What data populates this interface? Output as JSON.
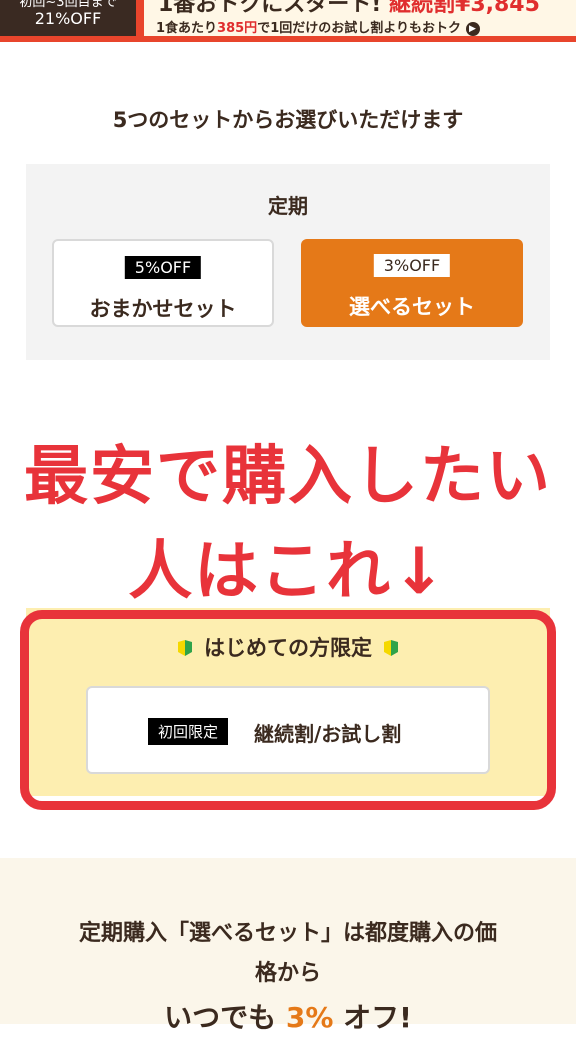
{
  "banner": {
    "left_line1": "初回~3回目まで",
    "left_line2": "21%OFF",
    "right_line1_prefix": "1番おトクにスタート!",
    "right_line1_red": "継続割¥3,845",
    "right_line2_prefix": "1食あたり",
    "right_line2_price": "385円",
    "right_line2_suffix": "で1回だけのお試し割よりもおトク"
  },
  "heading": "5つのセットからお選びいただけます",
  "subscription": {
    "title": "定期",
    "options": [
      {
        "badge": "5%OFF",
        "label": "おまかせセット"
      },
      {
        "badge": "3%OFF",
        "label": "選べるセット"
      }
    ]
  },
  "overlay_text": {
    "line1": "最安で購入したい",
    "line2": "人はこれ↓"
  },
  "first_time": {
    "title": "はじめての方限定",
    "badge": "初回限定",
    "label": "継続割/お試し割"
  },
  "bottom": {
    "line1": "定期購入「選べるセット」は都度購入の価",
    "line2": "格から",
    "line3_prefix": "いつでも",
    "line3_highlight": "3%",
    "line3_suffix": "オフ!"
  },
  "colors": {
    "accent_orange": "#e57918",
    "emphasis_red": "#e8333a",
    "highlight_yellow": "#fdeeb0"
  },
  "icons": [
    "arrow-right-icon",
    "beginner-leaf-icon"
  ]
}
